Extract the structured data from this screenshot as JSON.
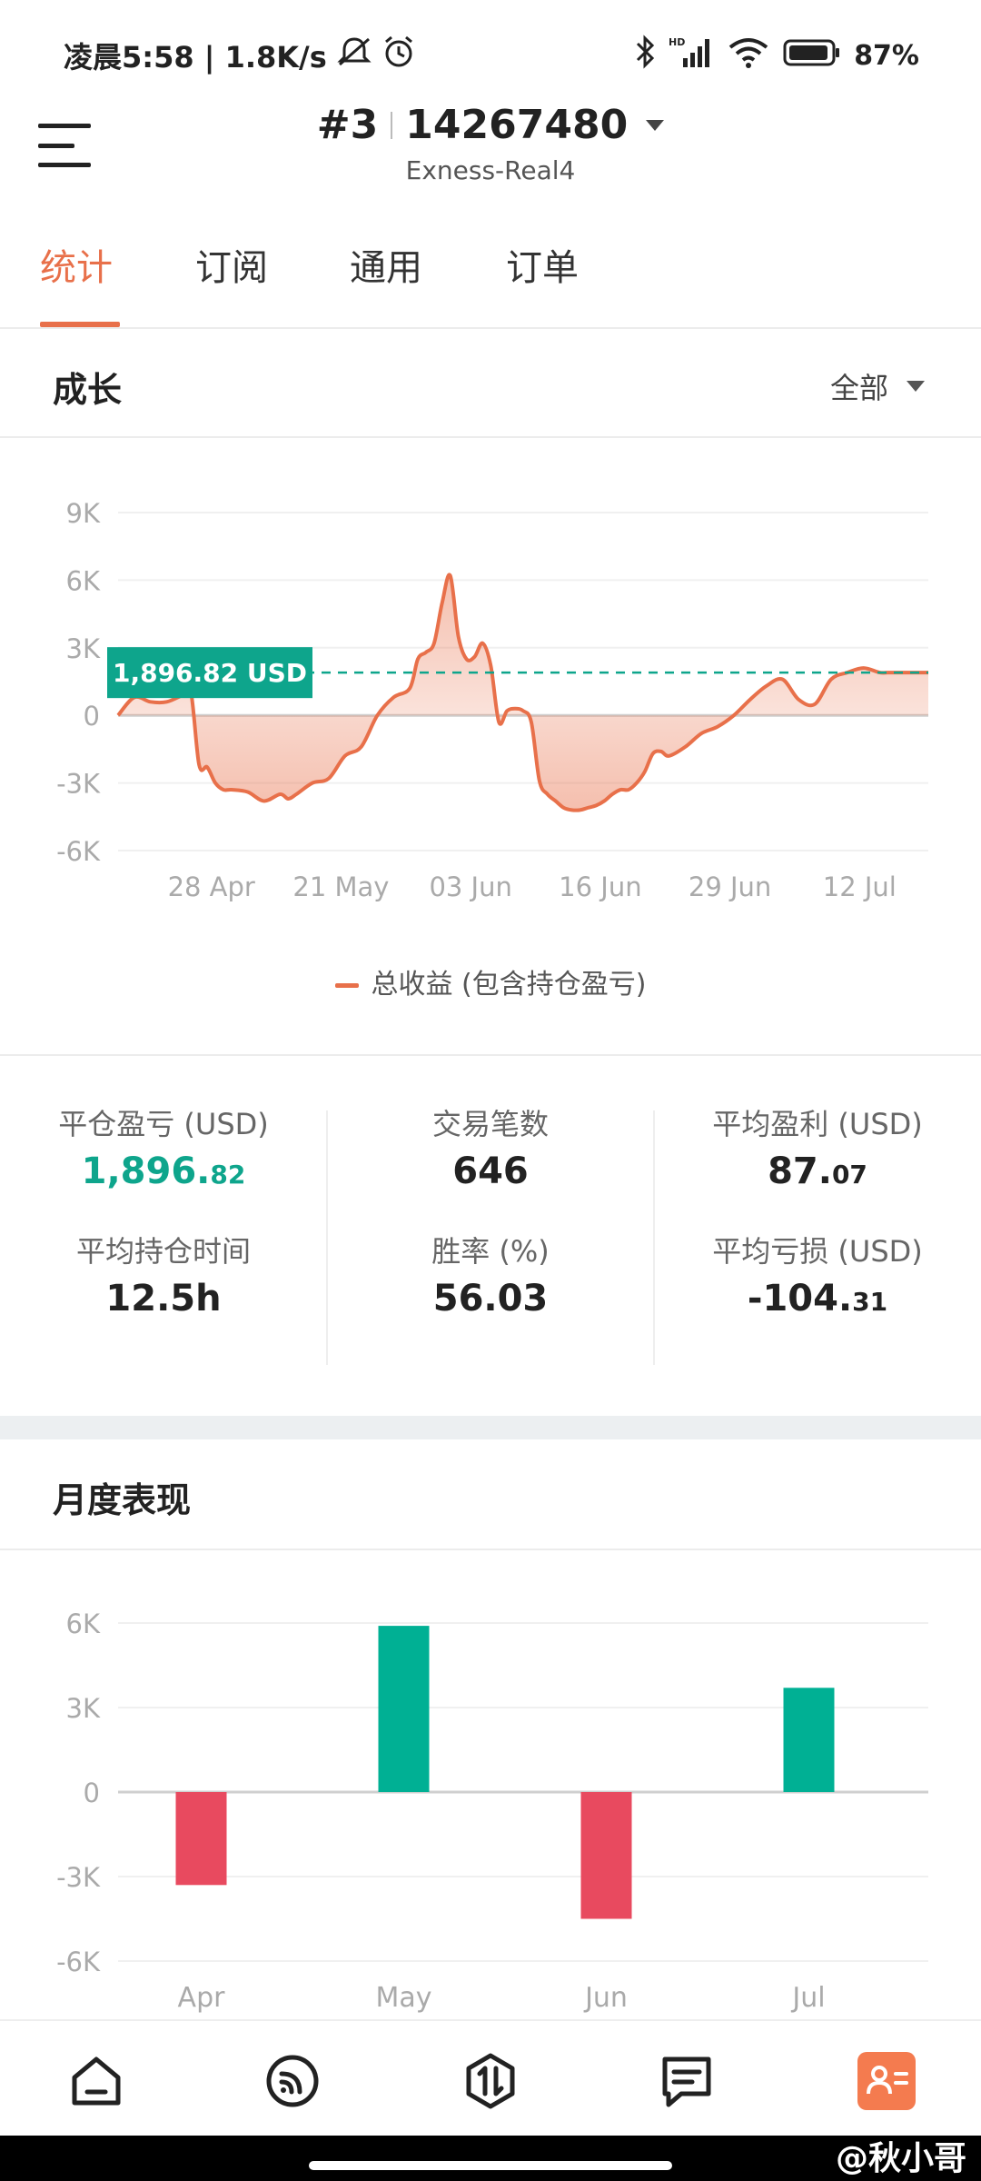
{
  "status_bar": {
    "time_and_speed": "凌晨5:58 | 1.8K/s",
    "battery": "87%",
    "network_label": "HD"
  },
  "header": {
    "account_index": "#3",
    "account_number": "14267480",
    "server": "Exness-Real4"
  },
  "tabs": [
    {
      "label": "统计",
      "active": true
    },
    {
      "label": "订阅",
      "active": false
    },
    {
      "label": "通用",
      "active": false
    },
    {
      "label": "订单",
      "active": false
    }
  ],
  "growth": {
    "title": "成长",
    "filter_label": "全部",
    "legend": "总收益 (包含持仓盈亏)",
    "current_value_label": "1,896.82 USD"
  },
  "stats": {
    "closed_pl_label": "平仓盈亏 (USD)",
    "closed_pl_int": "1,896.",
    "closed_pl_dec": "82",
    "trades_label": "交易笔数",
    "trades_value": "646",
    "avg_profit_label": "平均盈利 (USD)",
    "avg_profit_int": "87.",
    "avg_profit_dec": "07",
    "avg_hold_label": "平均持仓时间",
    "avg_hold_value": "12.5h",
    "win_rate_label": "胜率 (%)",
    "win_rate_value": "56.03",
    "avg_loss_label": "平均亏损 (USD)",
    "avg_loss_int": "-104.",
    "avg_loss_dec": "31"
  },
  "monthly": {
    "title": "月度表现"
  },
  "watermark": "@秋小哥",
  "colors": {
    "accent": "#e8704a",
    "positive": "#00b094",
    "negative": "#e84a5f",
    "label_bg": "#0ea58c"
  },
  "chart_data": [
    {
      "type": "area",
      "title": "",
      "xlabel": "",
      "ylabel": "",
      "ylim": [
        -6000,
        9000
      ],
      "y_ticks": [
        "9K",
        "6K",
        "3K",
        "0",
        "-3K",
        "-6K"
      ],
      "y_tick_values": [
        9000,
        6000,
        3000,
        0,
        -3000,
        -6000
      ],
      "x_tick_labels": [
        "28 Apr",
        "21 May",
        "03 Jun",
        "16 Jun",
        "29 Jun",
        "12 Jul"
      ],
      "x_tick_positions": [
        0.16,
        0.32,
        0.48,
        0.64,
        0.8,
        0.96
      ],
      "reference_value": 1896.82,
      "series": [
        {
          "name": "总收益 (包含持仓盈亏)",
          "x": [
            0.0,
            0.02,
            0.04,
            0.06,
            0.08,
            0.09,
            0.1,
            0.11,
            0.12,
            0.13,
            0.14,
            0.16,
            0.18,
            0.2,
            0.21,
            0.22,
            0.24,
            0.26,
            0.28,
            0.3,
            0.32,
            0.34,
            0.36,
            0.37,
            0.38,
            0.39,
            0.4,
            0.41,
            0.42,
            0.43,
            0.44,
            0.45,
            0.46,
            0.47,
            0.48,
            0.49,
            0.5,
            0.51,
            0.52,
            0.53,
            0.54,
            0.55,
            0.56,
            0.57,
            0.58,
            0.59,
            0.6,
            0.61,
            0.62,
            0.63,
            0.64,
            0.65,
            0.66,
            0.67,
            0.68,
            0.7,
            0.72,
            0.74,
            0.76,
            0.78,
            0.8,
            0.82,
            0.84,
            0.86,
            0.88,
            0.9,
            0.92,
            0.94,
            0.95,
            0.96,
            0.97,
            0.98,
            1.0
          ],
          "values": [
            0,
            800,
            600,
            600,
            900,
            1000,
            -2200,
            -2300,
            -3000,
            -3300,
            -3300,
            -3400,
            -3800,
            -3500,
            -3700,
            -3500,
            -3000,
            -2800,
            -1800,
            -1400,
            0,
            800,
            1200,
            2500,
            2800,
            3200,
            5000,
            6200,
            3500,
            2500,
            2600,
            3200,
            2200,
            -300,
            200,
            300,
            200,
            -300,
            -2900,
            -3500,
            -3800,
            -4100,
            -4200,
            -4200,
            -4100,
            -4000,
            -3800,
            -3500,
            -3300,
            -3300,
            -3000,
            -2500,
            -1700,
            -1600,
            -1800,
            -1400,
            -800,
            -500,
            0,
            700,
            1300,
            1600,
            700,
            500,
            1600,
            1900,
            2100,
            1900,
            1900,
            1900,
            1900,
            1900,
            1900
          ]
        }
      ]
    },
    {
      "type": "bar",
      "title": "",
      "xlabel": "",
      "ylabel": "",
      "ylim": [
        -6000,
        6000
      ],
      "y_ticks": [
        "6K",
        "3K",
        "0",
        "-3K",
        "-6K"
      ],
      "y_tick_values": [
        6000,
        3000,
        0,
        -3000,
        -6000
      ],
      "categories": [
        "Apr",
        "May",
        "Jun",
        "Jul"
      ],
      "values": [
        -3300,
        5900,
        -4500,
        3700
      ]
    }
  ]
}
